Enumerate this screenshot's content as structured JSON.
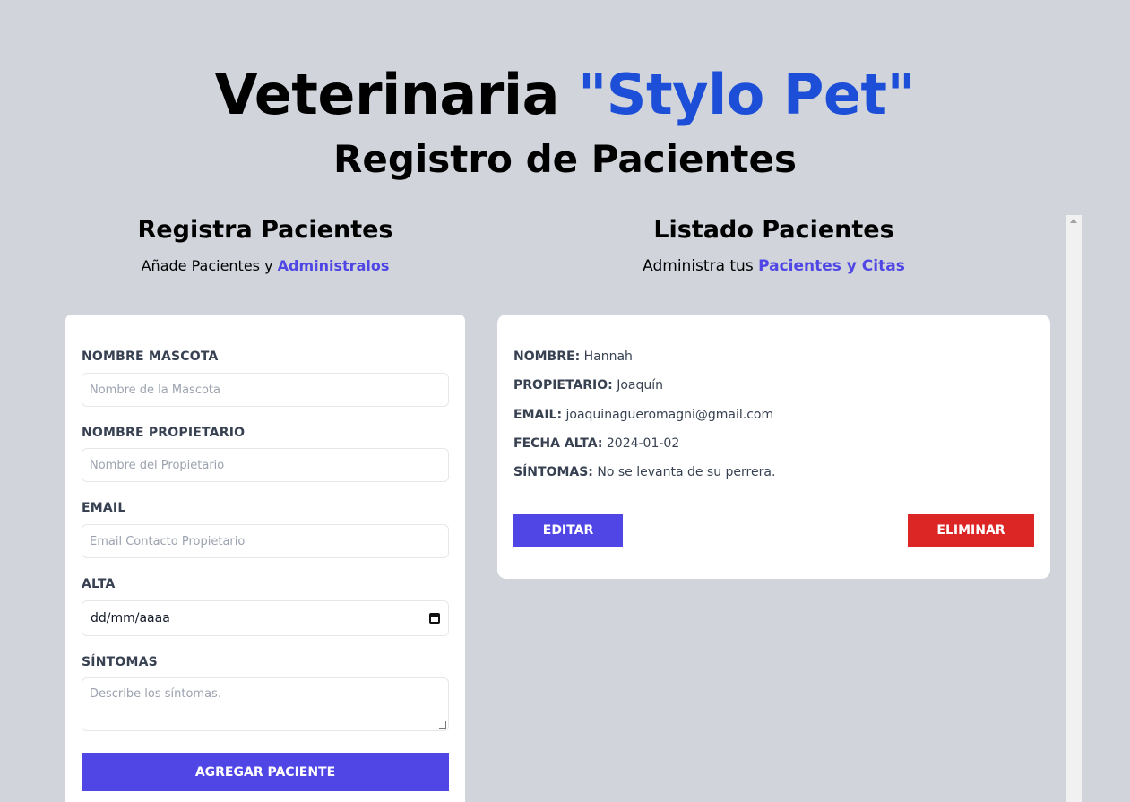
{
  "header": {
    "title_prefix": "Veterinaria ",
    "title_accent": "\"Stylo Pet\"",
    "subtitle": "Registro de Pacientes"
  },
  "form_section": {
    "heading": "Registra Pacientes",
    "desc_prefix": "Añade Pacientes y ",
    "desc_highlight": "Administralos"
  },
  "list_section": {
    "heading": "Listado Pacientes",
    "desc_prefix": "Administra tus ",
    "desc_highlight": "Pacientes y Citas"
  },
  "form": {
    "pet_name": {
      "label": "NOMBRE MASCOTA",
      "placeholder": "Nombre de la Mascota",
      "value": ""
    },
    "owner_name": {
      "label": "NOMBRE PROPIETARIO",
      "placeholder": "Nombre del Propietario",
      "value": ""
    },
    "email": {
      "label": "EMAIL",
      "placeholder": "Email Contacto Propietario",
      "value": ""
    },
    "date": {
      "label": "ALTA",
      "value": "dd/mm/aaaa",
      "icon": "calendar-icon"
    },
    "symptoms": {
      "label": "SÍNTOMAS",
      "placeholder": "Describe los síntomas.",
      "value": ""
    },
    "submit_label": "AGREGAR PACIENTE"
  },
  "patients": [
    {
      "name_key": "NOMBRE:",
      "name": "Hannah",
      "owner_key": "PROPIETARIO:",
      "owner": "Joaquín",
      "email_key": "EMAIL:",
      "email": "joaquinagueromagni@gmail.com",
      "date_key": "FECHA ALTA:",
      "date": "2024-01-02",
      "symptoms_key": "SÍNTOMAS:",
      "symptoms": "No se levanta de su perrera.",
      "edit_label": "EDITAR",
      "delete_label": "ELIMINAR"
    }
  ],
  "colors": {
    "background": "#d1d5db",
    "accent_blue": "#1d4ed8",
    "indigo": "#4f46e5",
    "danger": "#dc2626"
  }
}
